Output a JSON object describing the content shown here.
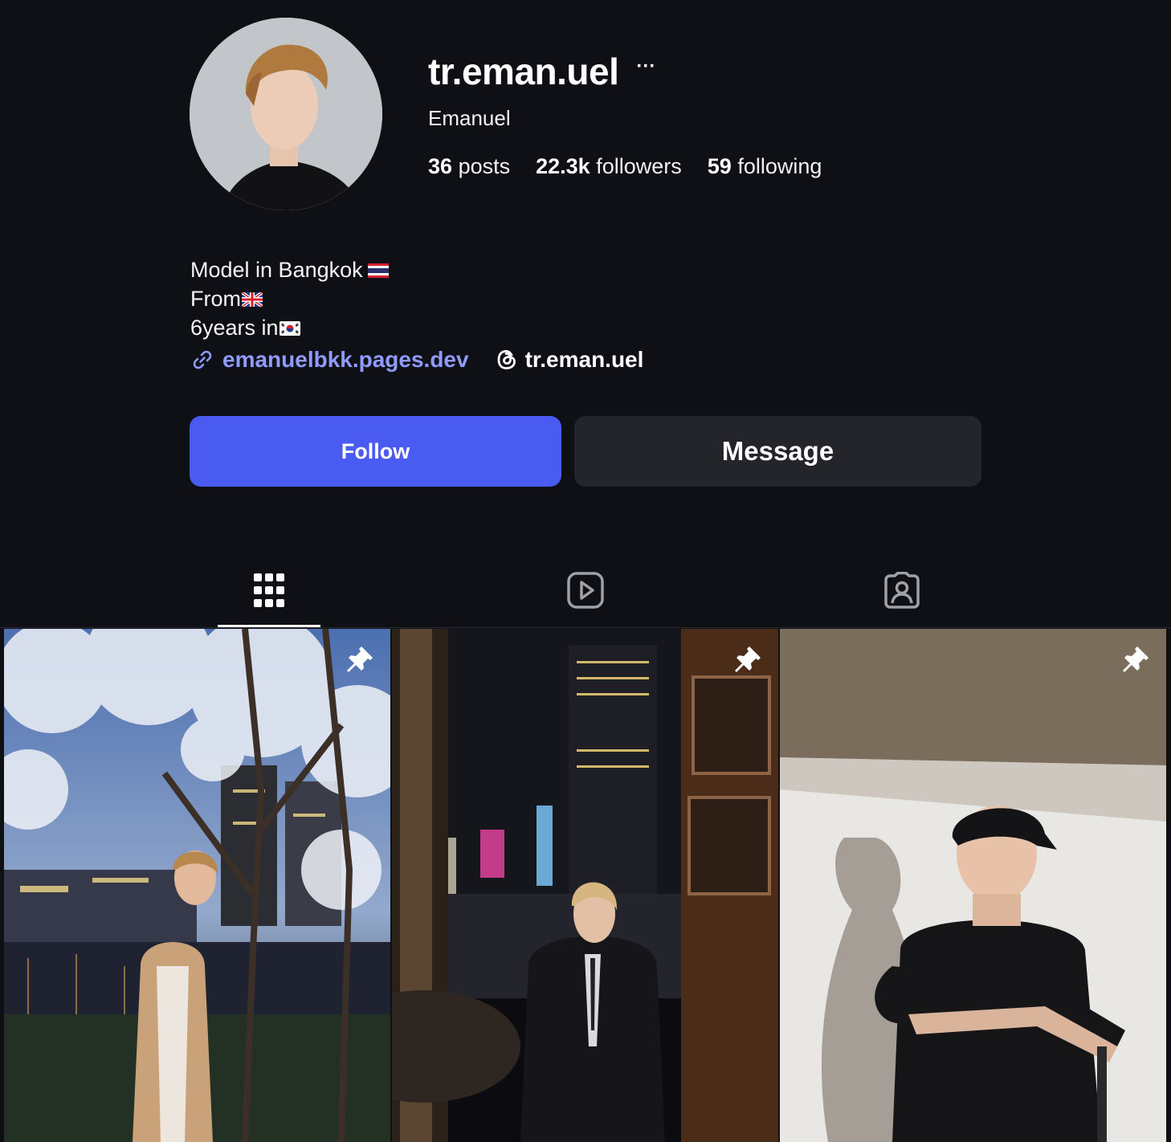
{
  "profile": {
    "username": "tr.eman.uel",
    "more_label": "···",
    "full_name": "Emanuel",
    "stats": {
      "posts_count": "36",
      "posts_label": "posts",
      "followers_count": "22.3k",
      "followers_label": "followers",
      "following_count": "59",
      "following_label": "following"
    },
    "bio": {
      "line1": "Model in Bangkok",
      "line1_flag": "thailand-flag",
      "line2": "From",
      "line2_flag": "uk-flag",
      "line3": "6years in",
      "line3_flag": "south-korea-flag"
    },
    "website": {
      "icon": "link-icon",
      "text": "emanuelbkk.pages.dev"
    },
    "threads": {
      "icon": "threads-icon",
      "text": "tr.eman.uel"
    }
  },
  "actions": {
    "follow_label": "Follow",
    "message_label": "Message"
  },
  "colors": {
    "accent": "#4a5bf2",
    "link": "#8f9bff",
    "background": "#0f1016",
    "secondary_button": "#24252b"
  },
  "tabs": [
    {
      "icon": "grid-icon",
      "active": true
    },
    {
      "icon": "reels-icon",
      "active": false
    },
    {
      "icon": "tagged-icon",
      "active": false
    }
  ],
  "posts": [
    {
      "subject": "cherry-blossoms-night-city",
      "pinned": true
    },
    {
      "subject": "man-in-suit-by-window",
      "pinned": true
    },
    {
      "subject": "man-in-cap-and-polo",
      "pinned": true
    }
  ]
}
